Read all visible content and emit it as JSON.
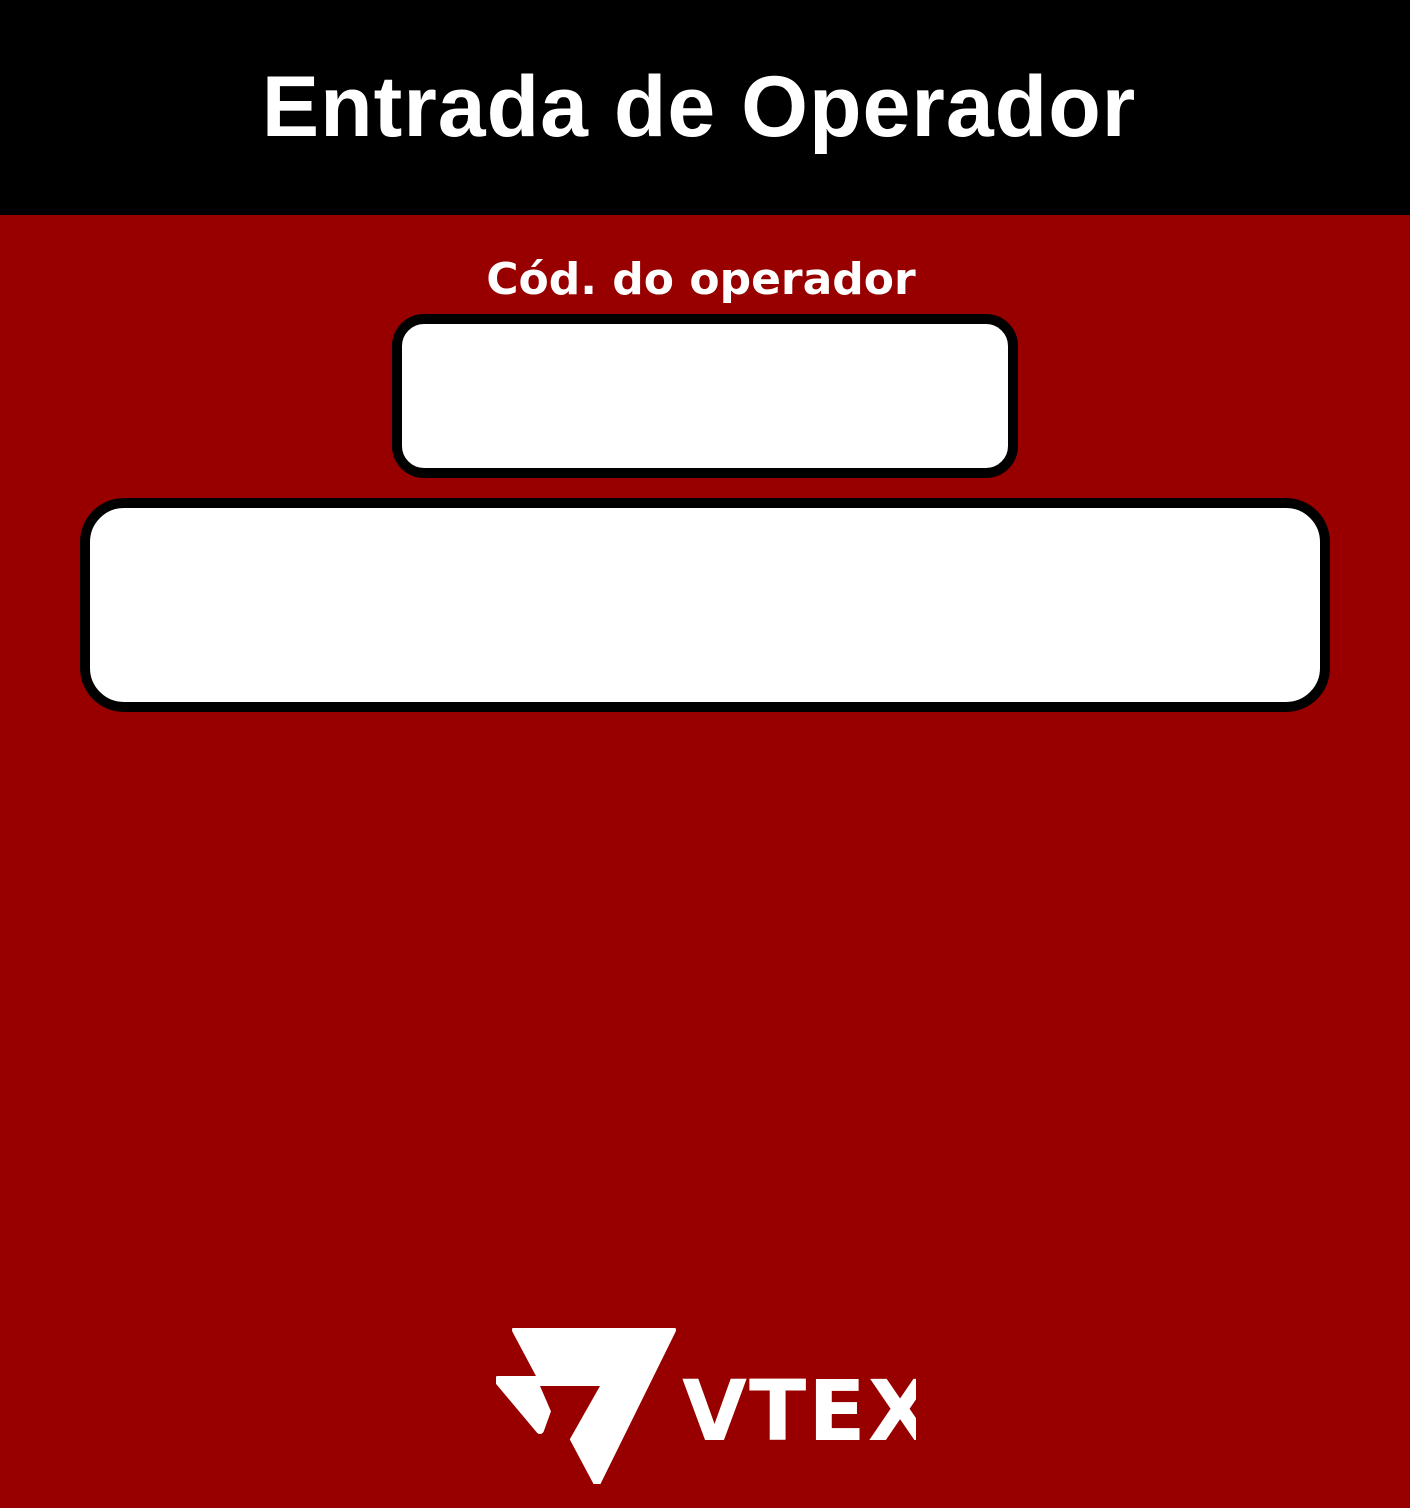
{
  "header": {
    "title": "Entrada de Operador"
  },
  "form": {
    "operator_code_label": "Cód. do operador",
    "operator_code_value": "",
    "enter_button_label": ""
  },
  "logo": {
    "brand_text": "VTEX",
    "icon": "vtex-logo-icon"
  },
  "colors": {
    "background": "#980000",
    "header": "#000000",
    "text": "#ffffff",
    "field_fill": "#ffffff",
    "field_border": "#000000"
  }
}
